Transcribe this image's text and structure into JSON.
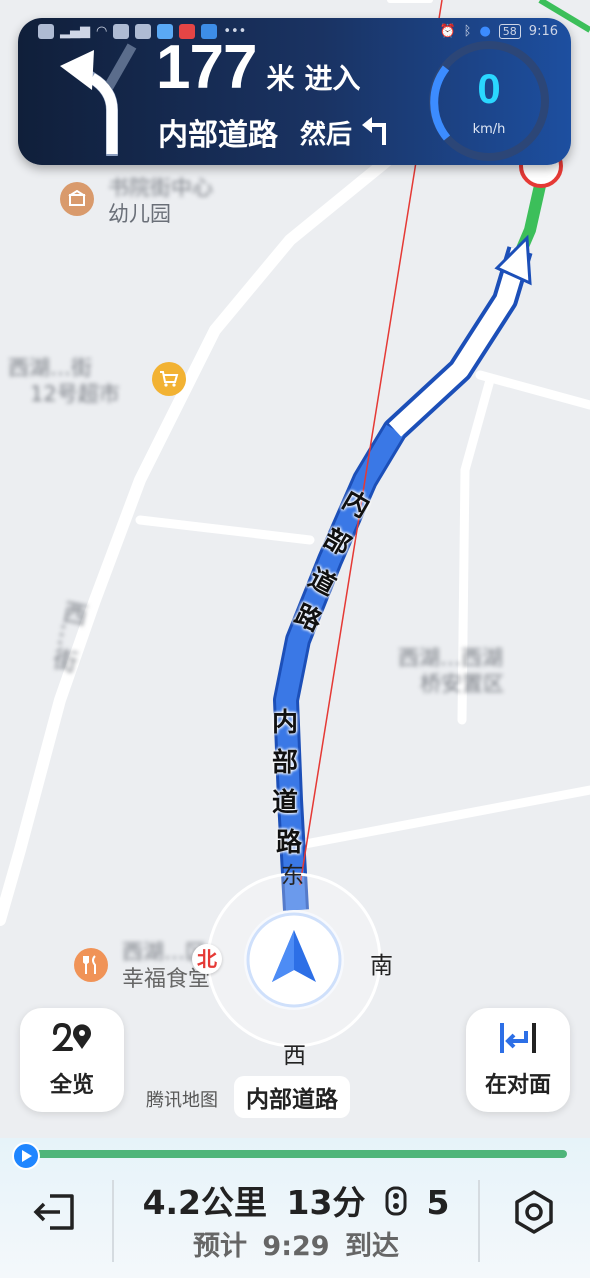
{
  "header": {
    "distance_value": "177",
    "distance_unit": "米",
    "action": "进入",
    "road_name": "内部道路",
    "then_label": "然后",
    "speed_value": "0",
    "speed_unit": "km/h",
    "status_time": "9:16",
    "battery": "58"
  },
  "map": {
    "pois": [
      {
        "name": "书院街中心",
        "sub": "幼儿园",
        "icon": "kindergarten-icon"
      },
      {
        "name": "西湖…街",
        "sub": "12号超市",
        "icon": "shopping-cart-icon"
      },
      {
        "name": "西湖…区",
        "sub": "幸福食堂",
        "icon": "restaurant-icon"
      },
      {
        "name": "西湖…西湖",
        "sub": "桥安置区",
        "icon": ""
      }
    ],
    "street_vertical": "西…街",
    "route_label_1": [
      "内",
      "部",
      "道",
      "路"
    ],
    "route_label_2": [
      "内",
      "部",
      "道",
      "路"
    ]
  },
  "compass": {
    "north": "北",
    "east": "东",
    "south": "南",
    "west": "西"
  },
  "buttons": {
    "overview": "全览",
    "opposite": "在对面"
  },
  "brand": "腾讯地图",
  "current_road": "内部道路",
  "trip": {
    "distance": "4.2公里",
    "time": "13分",
    "lights": "5",
    "eta_prefix": "预计",
    "eta_time": "9:29",
    "eta_suffix": "到达",
    "progress": 0.02
  },
  "colors": {
    "route": "#3a78e6",
    "accent": "#2ad7ff",
    "progress": "#4fb57a"
  }
}
